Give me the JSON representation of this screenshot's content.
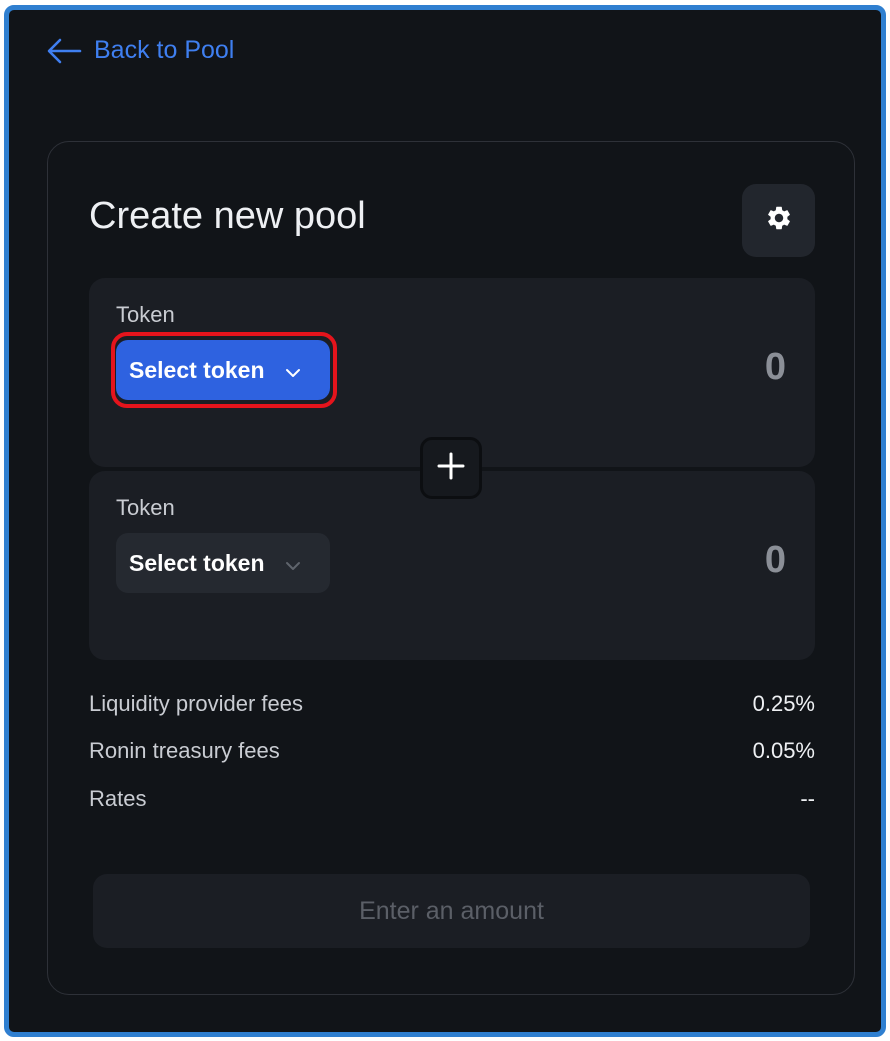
{
  "nav": {
    "back_label": "Back to Pool"
  },
  "card": {
    "title": "Create new pool"
  },
  "token_a": {
    "label": "Token",
    "select_label": "Select token",
    "amount": "0"
  },
  "token_b": {
    "label": "Token",
    "select_label": "Select token",
    "amount": "0"
  },
  "fees": [
    {
      "label": "Liquidity provider fees",
      "value": "0.25%"
    },
    {
      "label": "Ronin treasury fees",
      "value": "0.05%"
    },
    {
      "label": "Rates",
      "value": "--"
    }
  ],
  "submit": {
    "label": "Enter an amount"
  },
  "icons": {
    "back": "arrow-left-icon",
    "settings": "gear-icon",
    "add": "plus-icon",
    "dropdown": "chevron-down-icon"
  },
  "colors": {
    "accent": "#2e62e0",
    "link": "#3f7ff0",
    "highlight": "#e5141c",
    "background": "#111418"
  }
}
